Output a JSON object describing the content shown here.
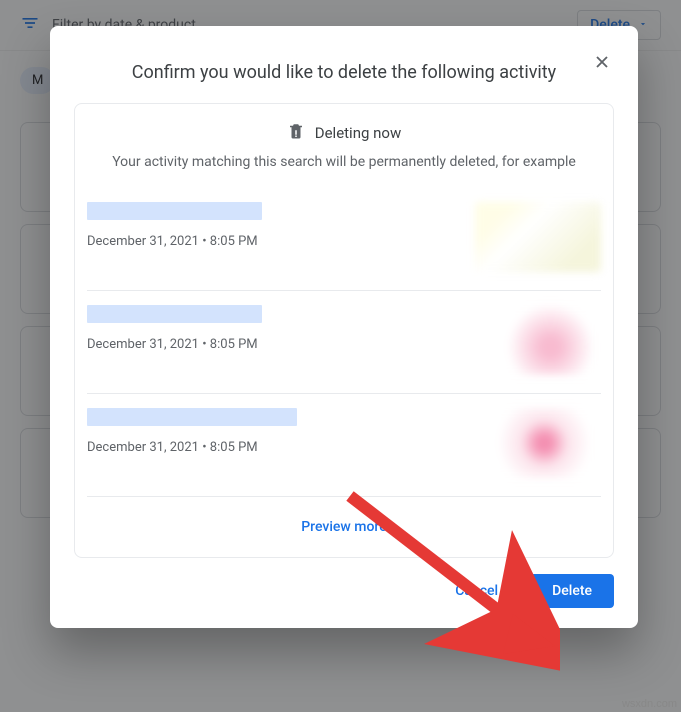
{
  "background": {
    "filter_label": "Filter by date & product",
    "delete_label": "Delete",
    "chip_label": "M"
  },
  "modal": {
    "title": "Confirm you would like to delete the following activity",
    "deleting_label": "Deleting now",
    "subtext": "Your activity matching this search will be permanently deleted, for example",
    "items": [
      {
        "timestamp": "December 31, 2021 • 8:05 PM"
      },
      {
        "timestamp": "December 31, 2021 • 8:05 PM"
      },
      {
        "timestamp": "December 31, 2021 • 8:05 PM"
      }
    ],
    "preview_more_label": "Preview more",
    "cancel_label": "Cancel",
    "delete_label": "Delete"
  },
  "watermark": "wsxdn.com"
}
